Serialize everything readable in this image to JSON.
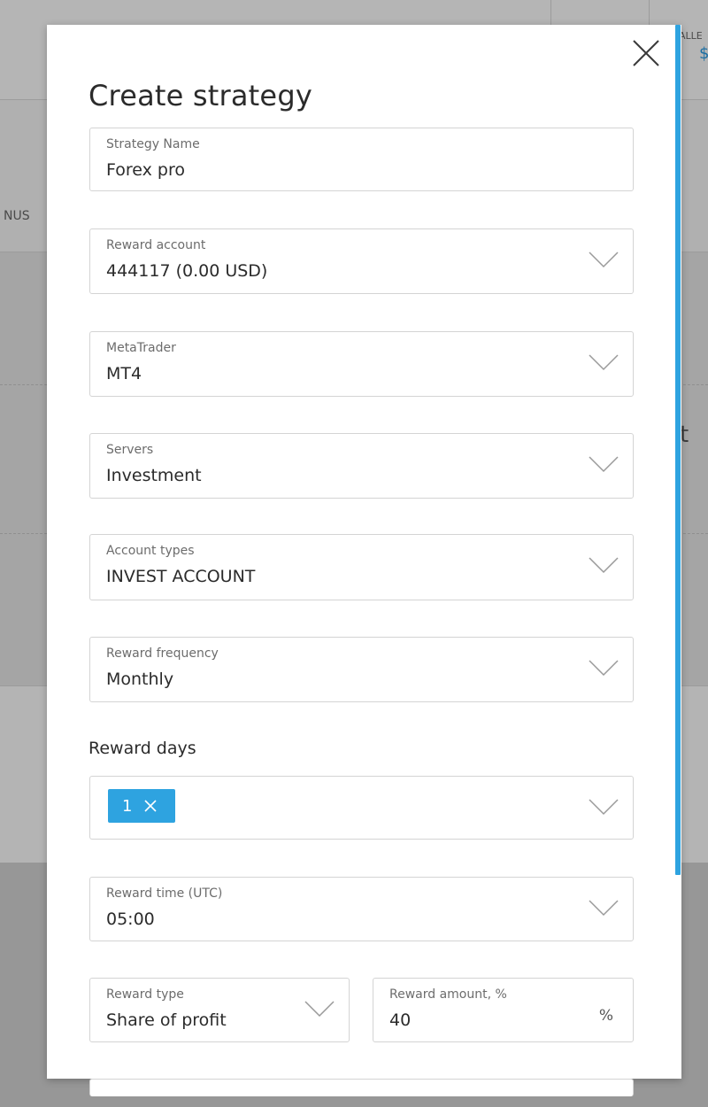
{
  "background": {
    "left_partial_text": "NUS",
    "top_right_partial_text": "ALLE",
    "top_right_value": "$",
    "right_partial_text": "t"
  },
  "modal": {
    "title": "Create strategy",
    "fields": {
      "strategy_name": {
        "label": "Strategy Name",
        "value": "Forex pro"
      },
      "reward_account": {
        "label": "Reward account",
        "value": "444117 (0.00 USD)"
      },
      "metatrader": {
        "label": "MetaTrader",
        "value": "MT4"
      },
      "servers": {
        "label": "Servers",
        "value": "Investment"
      },
      "account_types": {
        "label": "Account types",
        "value": "INVEST ACCOUNT"
      },
      "reward_frequency": {
        "label": "Reward frequency",
        "value": "Monthly"
      },
      "reward_days": {
        "heading": "Reward days",
        "tags": [
          "1"
        ]
      },
      "reward_time": {
        "label": "Reward time (UTC)",
        "value": "05:00"
      },
      "reward_type": {
        "label": "Reward type",
        "value": "Share of profit"
      },
      "reward_amount": {
        "label": "Reward amount, %",
        "value": "40",
        "suffix": "%"
      }
    }
  },
  "colors": {
    "accent": "#2ea3e0",
    "text_primary": "#2b2b2b",
    "text_label": "#6c6c6c",
    "field_border": "#d4d4d4",
    "overlay": "#a9a9a9"
  },
  "icons": {
    "close": "close-icon",
    "dropdown": "chevron-down-icon",
    "tag_remove": "close-icon"
  }
}
